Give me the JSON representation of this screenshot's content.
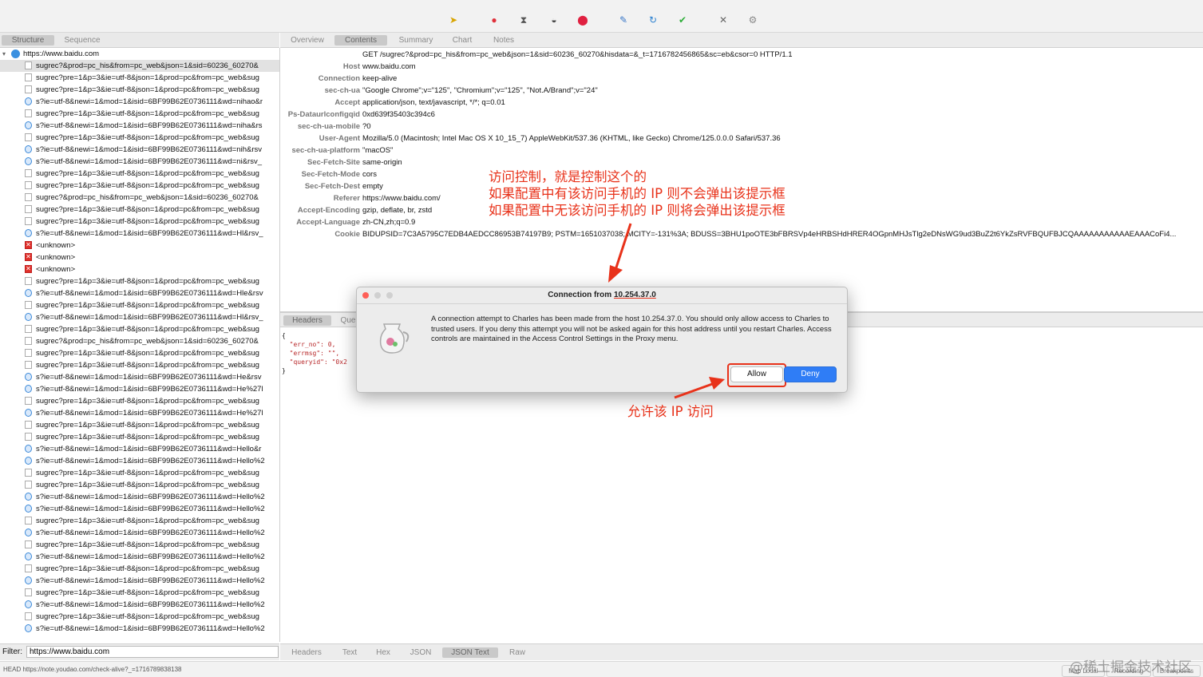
{
  "toolbar": {
    "icons": [
      "broom-icon",
      "record-icon",
      "throttle-icon",
      "turtle-icon",
      "breakpoint-icon",
      "pen-icon",
      "refresh-icon",
      "check-icon",
      "tools-icon",
      "settings-icon"
    ]
  },
  "left_tabs": [
    "Structure",
    "Sequence"
  ],
  "right_tabs": [
    "Overview",
    "Contents",
    "Summary",
    "Chart",
    "Notes"
  ],
  "host": "https://www.baidu.com",
  "tree_rows": [
    {
      "icon": "doc",
      "text": "sugrec?&prod=pc_his&from=pc_web&json=1&sid=60236_60270&",
      "selected": true
    },
    {
      "icon": "doc",
      "text": "sugrec?pre=1&p=3&ie=utf-8&json=1&prod=pc&from=pc_web&sug"
    },
    {
      "icon": "doc",
      "text": "sugrec?pre=1&p=3&ie=utf-8&json=1&prod=pc&from=pc_web&sug"
    },
    {
      "icon": "blue",
      "text": "s?ie=utf-8&newi=1&mod=1&isid=6BF99B62E0736111&wd=nihao&r"
    },
    {
      "icon": "doc",
      "text": "sugrec?pre=1&p=3&ie=utf-8&json=1&prod=pc&from=pc_web&sug"
    },
    {
      "icon": "blue",
      "text": "s?ie=utf-8&newi=1&mod=1&isid=6BF99B62E0736111&wd=niha&rs"
    },
    {
      "icon": "doc",
      "text": "sugrec?pre=1&p=3&ie=utf-8&json=1&prod=pc&from=pc_web&sug"
    },
    {
      "icon": "blue",
      "text": "s?ie=utf-8&newi=1&mod=1&isid=6BF99B62E0736111&wd=nih&rsv"
    },
    {
      "icon": "blue",
      "text": "s?ie=utf-8&newi=1&mod=1&isid=6BF99B62E0736111&wd=ni&rsv_"
    },
    {
      "icon": "doc",
      "text": "sugrec?pre=1&p=3&ie=utf-8&json=1&prod=pc&from=pc_web&sug"
    },
    {
      "icon": "doc",
      "text": "sugrec?pre=1&p=3&ie=utf-8&json=1&prod=pc&from=pc_web&sug"
    },
    {
      "icon": "doc",
      "text": "sugrec?&prod=pc_his&from=pc_web&json=1&sid=60236_60270&"
    },
    {
      "icon": "doc",
      "text": "sugrec?pre=1&p=3&ie=utf-8&json=1&prod=pc&from=pc_web&sug"
    },
    {
      "icon": "doc",
      "text": "sugrec?pre=1&p=3&ie=utf-8&json=1&prod=pc&from=pc_web&sug"
    },
    {
      "icon": "blue",
      "text": "s?ie=utf-8&newi=1&mod=1&isid=6BF99B62E0736111&wd=Hl&rsv_"
    },
    {
      "icon": "red",
      "text": "<unknown>"
    },
    {
      "icon": "red",
      "text": "<unknown>"
    },
    {
      "icon": "red",
      "text": "<unknown>"
    },
    {
      "icon": "doc",
      "text": "sugrec?pre=1&p=3&ie=utf-8&json=1&prod=pc&from=pc_web&sug"
    },
    {
      "icon": "blue",
      "text": "s?ie=utf-8&newi=1&mod=1&isid=6BF99B62E0736111&wd=Hle&rsv"
    },
    {
      "icon": "doc",
      "text": "sugrec?pre=1&p=3&ie=utf-8&json=1&prod=pc&from=pc_web&sug"
    },
    {
      "icon": "blue",
      "text": "s?ie=utf-8&newi=1&mod=1&isid=6BF99B62E0736111&wd=Hl&rsv_"
    },
    {
      "icon": "doc",
      "text": "sugrec?pre=1&p=3&ie=utf-8&json=1&prod=pc&from=pc_web&sug"
    },
    {
      "icon": "doc",
      "text": "sugrec?&prod=pc_his&from=pc_web&json=1&sid=60236_60270&"
    },
    {
      "icon": "doc",
      "text": "sugrec?pre=1&p=3&ie=utf-8&json=1&prod=pc&from=pc_web&sug"
    },
    {
      "icon": "doc",
      "text": "sugrec?pre=1&p=3&ie=utf-8&json=1&prod=pc&from=pc_web&sug"
    },
    {
      "icon": "blue",
      "text": "s?ie=utf-8&newi=1&mod=1&isid=6BF99B62E0736111&wd=He&rsv"
    },
    {
      "icon": "blue",
      "text": "s?ie=utf-8&newi=1&mod=1&isid=6BF99B62E0736111&wd=He%27l"
    },
    {
      "icon": "doc",
      "text": "sugrec?pre=1&p=3&ie=utf-8&json=1&prod=pc&from=pc_web&sug"
    },
    {
      "icon": "blue",
      "text": "s?ie=utf-8&newi=1&mod=1&isid=6BF99B62E0736111&wd=He%27l"
    },
    {
      "icon": "doc",
      "text": "sugrec?pre=1&p=3&ie=utf-8&json=1&prod=pc&from=pc_web&sug"
    },
    {
      "icon": "doc",
      "text": "sugrec?pre=1&p=3&ie=utf-8&json=1&prod=pc&from=pc_web&sug"
    },
    {
      "icon": "blue",
      "text": "s?ie=utf-8&newi=1&mod=1&isid=6BF99B62E0736111&wd=Hello&r"
    },
    {
      "icon": "blue",
      "text": "s?ie=utf-8&newi=1&mod=1&isid=6BF99B62E0736111&wd=Hello%2"
    },
    {
      "icon": "doc",
      "text": "sugrec?pre=1&p=3&ie=utf-8&json=1&prod=pc&from=pc_web&sug"
    },
    {
      "icon": "doc",
      "text": "sugrec?pre=1&p=3&ie=utf-8&json=1&prod=pc&from=pc_web&sug"
    },
    {
      "icon": "blue",
      "text": "s?ie=utf-8&newi=1&mod=1&isid=6BF99B62E0736111&wd=Hello%2"
    },
    {
      "icon": "blue",
      "text": "s?ie=utf-8&newi=1&mod=1&isid=6BF99B62E0736111&wd=Hello%2"
    },
    {
      "icon": "doc",
      "text": "sugrec?pre=1&p=3&ie=utf-8&json=1&prod=pc&from=pc_web&sug"
    },
    {
      "icon": "blue",
      "text": "s?ie=utf-8&newi=1&mod=1&isid=6BF99B62E0736111&wd=Hello%2"
    },
    {
      "icon": "doc",
      "text": "sugrec?pre=1&p=3&ie=utf-8&json=1&prod=pc&from=pc_web&sug"
    },
    {
      "icon": "blue",
      "text": "s?ie=utf-8&newi=1&mod=1&isid=6BF99B62E0736111&wd=Hello%2"
    },
    {
      "icon": "doc",
      "text": "sugrec?pre=1&p=3&ie=utf-8&json=1&prod=pc&from=pc_web&sug"
    },
    {
      "icon": "blue",
      "text": "s?ie=utf-8&newi=1&mod=1&isid=6BF99B62E0736111&wd=Hello%2"
    },
    {
      "icon": "doc",
      "text": "sugrec?pre=1&p=3&ie=utf-8&json=1&prod=pc&from=pc_web&sug"
    },
    {
      "icon": "blue",
      "text": "s?ie=utf-8&newi=1&mod=1&isid=6BF99B62E0736111&wd=Hello%2"
    },
    {
      "icon": "doc",
      "text": "sugrec?pre=1&p=3&ie=utf-8&json=1&prod=pc&from=pc_web&sug"
    },
    {
      "icon": "blue",
      "text": "s?ie=utf-8&newi=1&mod=1&isid=6BF99B62E0736111&wd=Hello%2"
    }
  ],
  "request_line": "GET /sugrec?&prod=pc_his&from=pc_web&json=1&sid=60236_60270&hisdata=&_t=1716782456865&sc=eb&csor=0 HTTP/1.1",
  "headers": [
    {
      "k": "Host",
      "v": "www.baidu.com"
    },
    {
      "k": "Connection",
      "v": "keep-alive"
    },
    {
      "k": "sec-ch-ua",
      "v": "\"Google Chrome\";v=\"125\", \"Chromium\";v=\"125\", \"Not.A/Brand\";v=\"24\""
    },
    {
      "k": "Accept",
      "v": "application/json, text/javascript, */*; q=0.01"
    },
    {
      "k": "Ps-Dataurlconfigqid",
      "v": "0xd639f35403c394c6"
    },
    {
      "k": "sec-ch-ua-mobile",
      "v": "?0"
    },
    {
      "k": "User-Agent",
      "v": "Mozilla/5.0 (Macintosh; Intel Mac OS X 10_15_7) AppleWebKit/537.36 (KHTML, like Gecko) Chrome/125.0.0.0 Safari/537.36"
    },
    {
      "k": "sec-ch-ua-platform",
      "v": "\"macOS\""
    },
    {
      "k": "Sec-Fetch-Site",
      "v": "same-origin"
    },
    {
      "k": "Sec-Fetch-Mode",
      "v": "cors"
    },
    {
      "k": "Sec-Fetch-Dest",
      "v": "empty"
    },
    {
      "k": "Referer",
      "v": "https://www.baidu.com/"
    },
    {
      "k": "Accept-Encoding",
      "v": "gzip, deflate, br, zstd"
    },
    {
      "k": "Accept-Language",
      "v": "zh-CN,zh;q=0.9"
    },
    {
      "k": "Cookie",
      "v": "BIDUPSID=7C3A5795C7EDB4AEDCC86953B74197B9; PSTM=1651037038; MCITY=-131%3A; BDUSS=3BHU1poOTE3bFBRSVp4eHRBSHdHRER4OGpnMHJsTlg2eDNsWG9ud3BuZ2t6YkZsRVFBQUFBJCQAAAAAAAAAAAEAAACoFi4..."
    }
  ],
  "mid_tabs": [
    "Headers",
    "Que"
  ],
  "json_lines": [
    "{",
    "  \"err_no\": 0,",
    "  \"errmsg\": \"\",",
    "  \"queryid\": \"0x2",
    "}"
  ],
  "bottom_tabs": [
    "Headers",
    "Text",
    "Hex",
    "JSON",
    "JSON Text",
    "Raw"
  ],
  "filter": {
    "label": "Filter:",
    "value": "https://www.baidu.com"
  },
  "status_text": "HEAD https://note.youdao.com/check-alive?_=1716789838138",
  "status_buttons": [
    "Map Local",
    "Recording",
    "Breakpoints"
  ],
  "watermark": "@稀土掘金技术社区",
  "dialog": {
    "title_prefix": "Connection from ",
    "title_ip": "10.254.37.0",
    "message": "A connection attempt to Charles has been made from the host 10.254.37.0. You should only allow access to Charles to trusted users. If you deny this attempt you will not be asked again for this host address until you restart Charles. Access controls are maintained in the Access Control Settings in the Proxy menu.",
    "allow": "Allow",
    "deny": "Deny"
  },
  "annotations": {
    "line1": "访问控制，就是控制这个的",
    "line2": "如果配置中有该访问手机的 IP 则不会弹出该提示框",
    "line3": "如果配置中无该访问手机的 IP 则将会弹出该提示框",
    "allow_note": "允许该 IP 访问"
  },
  "colors": {
    "annotation": "#e8321a",
    "deny_button": "#2f7df6",
    "selected_tab": "#c9c9c9"
  }
}
